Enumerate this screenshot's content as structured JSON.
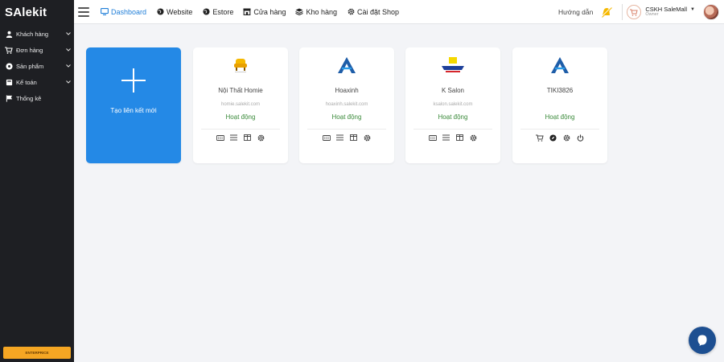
{
  "app": {
    "logo_text": "SAlekit"
  },
  "sidebar": {
    "items": [
      {
        "label": "Khách hàng",
        "icon": "person-icon",
        "has_chevron": true
      },
      {
        "label": "Đơn hàng",
        "icon": "cart-icon",
        "has_chevron": true
      },
      {
        "label": "Sản phẩm",
        "icon": "box-icon",
        "has_chevron": true
      },
      {
        "label": "Kế toán",
        "icon": "calculator-icon",
        "has_chevron": true
      },
      {
        "label": "Thống kê",
        "icon": "flag-icon",
        "has_chevron": false
      }
    ],
    "bottom_button": "ENTERPRICE"
  },
  "header": {
    "menu": [
      {
        "label": "Dashboard",
        "icon": "monitor-icon",
        "active": true
      },
      {
        "label": "Website",
        "icon": "globe-icon",
        "active": false
      },
      {
        "label": "Estore",
        "icon": "globe-icon",
        "active": false
      },
      {
        "label": "Cửa hàng",
        "icon": "store-icon",
        "active": false
      },
      {
        "label": "Kho hàng",
        "icon": "layers-icon",
        "active": false
      },
      {
        "label": "Cài đặt Shop",
        "icon": "gear-icon",
        "active": false
      }
    ],
    "guide_label": "Hướng dẫn",
    "user_name": "CSKH SaleMall",
    "user_role": "Owner"
  },
  "add_card": {
    "label": "Tạo liên kết mới"
  },
  "shops": [
    {
      "name": "Nội Thất Homie",
      "domain": "homie.salekit.com",
      "status": "Hoạt động",
      "logo": "chair-logo"
    },
    {
      "name": "Hoaxinh",
      "domain": "hoaxinh.salekit.com",
      "status": "Hoạt động",
      "logo": "a-logo"
    },
    {
      "name": "K Salon",
      "domain": "ksalon.salekit.com",
      "status": "Hoạt động",
      "logo": "k-salon-logo"
    },
    {
      "name": "TIKI3826",
      "domain": "",
      "status": "Hoạt động",
      "logo": "a-logo"
    }
  ],
  "colors": {
    "sidebar_bg": "#1e1f23",
    "accent_blue": "#2489e6",
    "status_green": "#3a8a3a",
    "enterprise_orange": "#f5a623",
    "chat_fab": "#1d4f91"
  }
}
